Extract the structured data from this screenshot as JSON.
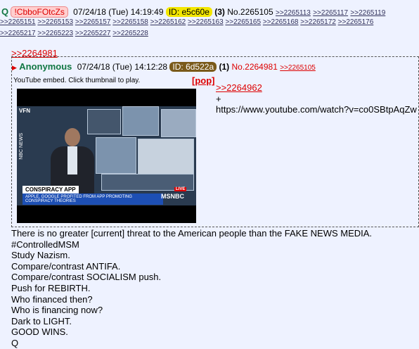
{
  "post": {
    "q_name": "Q",
    "tripcode": "!CbboFOtcZs",
    "date": "07/24/18 (Tue) 14:19:49",
    "id_label": "ID: e5c60e",
    "reply_count": "(3)",
    "number": "No.2265105",
    "backlinks_row1": [
      ">>2265113",
      ">>2265117",
      ">>2265119"
    ],
    "backlinks_row2": [
      ">>2265151",
      ">>2265153",
      ">>2265157",
      ">>2265158",
      ">>2265162",
      ">>2265163",
      ">>2265165",
      ">>2265168",
      ">>2265172",
      ">>2265176"
    ],
    "backlinks_row3": [
      ">>2265217",
      ">>2265223",
      ">>2265227",
      ">>2265228"
    ],
    "quote_link": ">>2264981",
    "body_lines": [
      "There is no greater [current] threat to the American people than the FAKE NEWS MEDIA.",
      "#ControlledMSM",
      "Study Nazism.",
      "Compare/contrast ANTIFA.",
      "Compare/contrast SOCIALISM push.",
      "Push for REBIRTH.",
      "Who financed then?",
      "Who is financing now?",
      "Dark to LIGHT.",
      "GOOD WINS.",
      "Q"
    ]
  },
  "inline_post": {
    "arrow": "▶",
    "name": "Anonymous",
    "date": "07/24/18 (Tue) 14:12:28",
    "id_label": "ID: 6d522a",
    "reply_count": "(1)",
    "number": "No.2264981",
    "backlink": ">>2265105",
    "yt_note": "YouTube embed. Click thumbnail to play.",
    "pop_label": "[pop]",
    "quote_link": ">>2264962",
    "plus": "+",
    "url": "https://www.youtube.com/watch?v=co0SBtpAqZw",
    "thumbnail": {
      "corner_logo": "VFN",
      "side_text": "NBC NEWS",
      "lower_third_title": "CONSPIRACY APP",
      "lower_third_text": "APPLE, GOOGLE PROFITED FROM APP PROMOTING CONSPIRACY THEORIES",
      "live_badge": "LIVE",
      "network": "MSNBC"
    }
  }
}
